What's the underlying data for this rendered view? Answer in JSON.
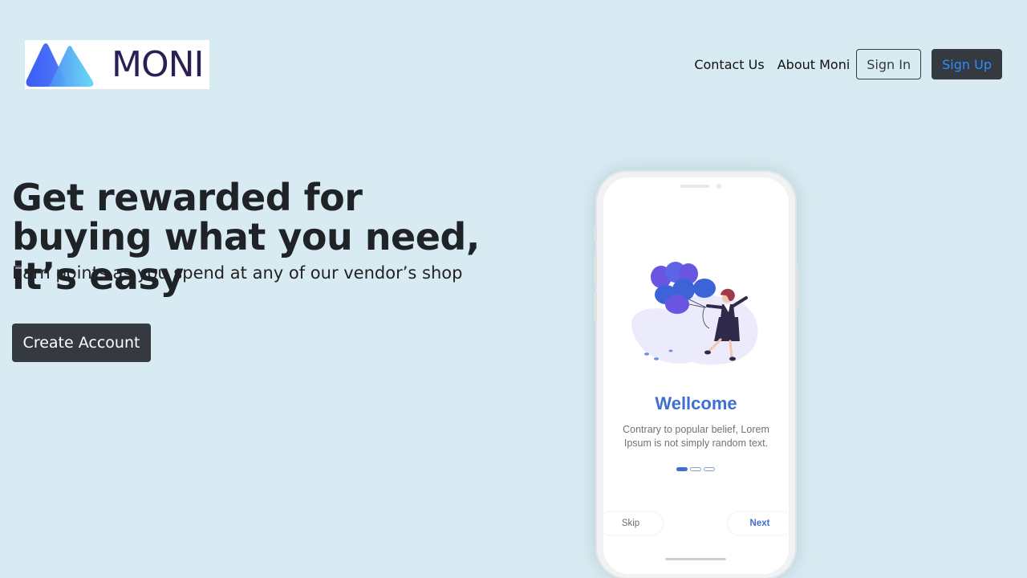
{
  "brand": {
    "logo_text": "MONI",
    "logo_colors": [
      "#3d63f5",
      "#5fd0f2",
      "#2b1f55"
    ]
  },
  "nav": {
    "contact_label": "Contact Us",
    "about_label": "About Moni",
    "signin_label": "Sign In",
    "signup_label": "Sign Up"
  },
  "hero": {
    "title": "Get rewarded for buying what you need, it’s easy",
    "subtitle": "Earn points as you spend at any of our vendor’s shop",
    "cta_label": "Create Account"
  },
  "phone": {
    "welcome_title": "Wellcome",
    "welcome_text": "Contrary to popular belief, Lorem Ipsum is not simply random text.",
    "skip_label": "Skip",
    "next_label": "Next",
    "pager": {
      "total": 3,
      "active": 1
    },
    "illustration_icon": "woman-with-balloons-illustration"
  },
  "colors": {
    "page_background": "#d9ebf2",
    "dark_button": "#343a40",
    "signup_text": "#2f8cff",
    "accent_blue": "#3f6fd1"
  }
}
